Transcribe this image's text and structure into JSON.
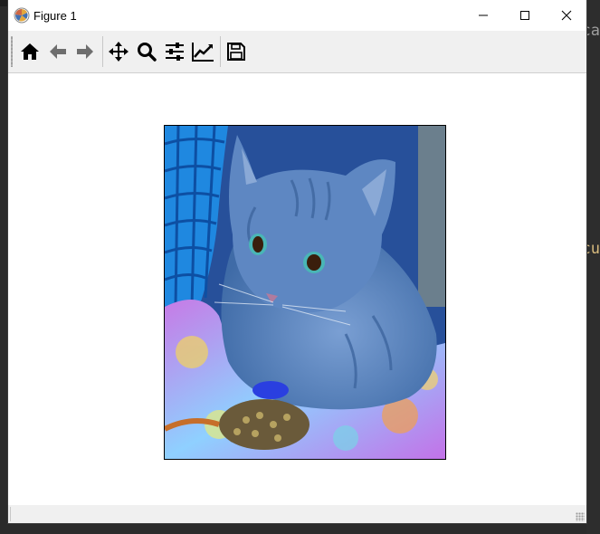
{
  "window": {
    "title": "Figure 1",
    "controls": {
      "minimize": "minimize-icon",
      "maximize": "maximize-icon",
      "close": "close-icon"
    }
  },
  "toolbar": {
    "buttons": [
      {
        "name": "home",
        "icon": "home-icon"
      },
      {
        "name": "back",
        "icon": "arrow-left-icon"
      },
      {
        "name": "forward",
        "icon": "arrow-right-icon"
      },
      {
        "name": "pan",
        "icon": "move-icon"
      },
      {
        "name": "zoom",
        "icon": "magnifier-icon"
      },
      {
        "name": "configure-subplots",
        "icon": "sliders-icon"
      },
      {
        "name": "edit-axes",
        "icon": "line-chart-icon"
      },
      {
        "name": "save",
        "icon": "floppy-disk-icon"
      }
    ]
  },
  "figure": {
    "content": "image-of-cat",
    "colors": {
      "cat_blue": "#5b86c2",
      "basket_blue": "#1f88e0",
      "fabric_purple": "#b66fe3"
    }
  },
  "background_editor": {
    "fragment_top": "ca",
    "fragment_mid": "cu"
  }
}
